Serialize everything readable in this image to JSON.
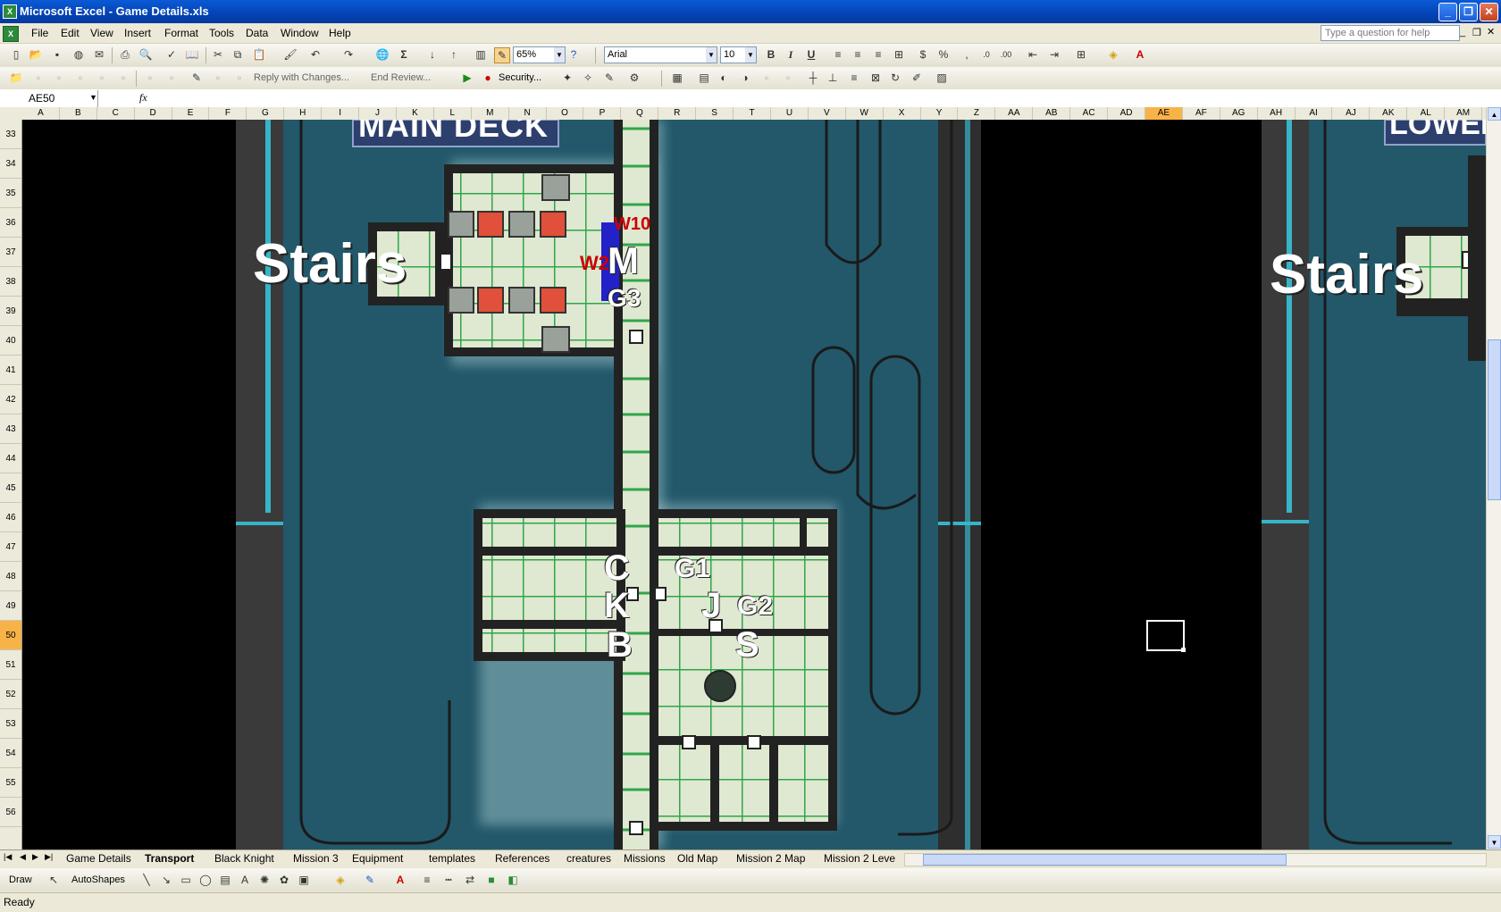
{
  "window": {
    "title": "Microsoft Excel - Game Details.xls",
    "app_icon": "X"
  },
  "menu": [
    "File",
    "Edit",
    "View",
    "Insert",
    "Format",
    "Tools",
    "Data",
    "Window",
    "Help"
  ],
  "help_box_placeholder": "Type a question for help",
  "toolbar": {
    "zoom": "65%",
    "font": "Arial",
    "font_size": "10"
  },
  "review_toolbar": {
    "reply": "Reply with Changes...",
    "end_review": "End Review...",
    "security": "Security..."
  },
  "formula_bar": {
    "name_box": "AE50",
    "fx": "fx",
    "formula": ""
  },
  "columns": [
    "A",
    "B",
    "C",
    "D",
    "E",
    "F",
    "G",
    "H",
    "I",
    "J",
    "K",
    "L",
    "M",
    "N",
    "O",
    "P",
    "Q",
    "R",
    "S",
    "T",
    "U",
    "V",
    "W",
    "X",
    "Y",
    "Z",
    "AA",
    "AB",
    "AC",
    "AD",
    "AE",
    "AF",
    "AG",
    "AH",
    "AI",
    "AJ",
    "AK",
    "AL",
    "AM"
  ],
  "selected_column": "AE",
  "rows": [
    "33",
    "34",
    "35",
    "36",
    "37",
    "38",
    "39",
    "40",
    "41",
    "42",
    "43",
    "44",
    "45",
    "46",
    "47",
    "48",
    "49",
    "50",
    "51",
    "52",
    "53",
    "54",
    "55",
    "56"
  ],
  "selected_row": "50",
  "map": {
    "main_deck_label": "MAIN DECK",
    "lower_label": "LOWER",
    "stairs_left": "Stairs",
    "stairs_right": "Stairs",
    "markers": {
      "w10": "W10",
      "w2": "W2",
      "m": "M",
      "g3": "G3",
      "c": "C",
      "k": "K",
      "b": "B",
      "g1": "G1",
      "j": "J",
      "g2": "G2",
      "s": "S"
    }
  },
  "sheet_tabs": [
    "Game Details",
    "Transport",
    "Black Knight",
    "Mission 3",
    "Equipment",
    "templates",
    "References",
    "creatures",
    "Missions",
    "Old Map",
    "Mission 2 Map",
    "Mission 2 Leve"
  ],
  "active_tab": "Transport",
  "draw_toolbar": {
    "draw": "Draw",
    "autoshapes": "AutoShapes"
  },
  "status": "Ready",
  "colors": {
    "sea": "#22586a",
    "deck_frame": "#2a2a2a",
    "grid_green": "#2fa64a",
    "tile": "#dfe8d0",
    "red_tile": "#e1503a",
    "blue_marker": "#2222c8"
  }
}
